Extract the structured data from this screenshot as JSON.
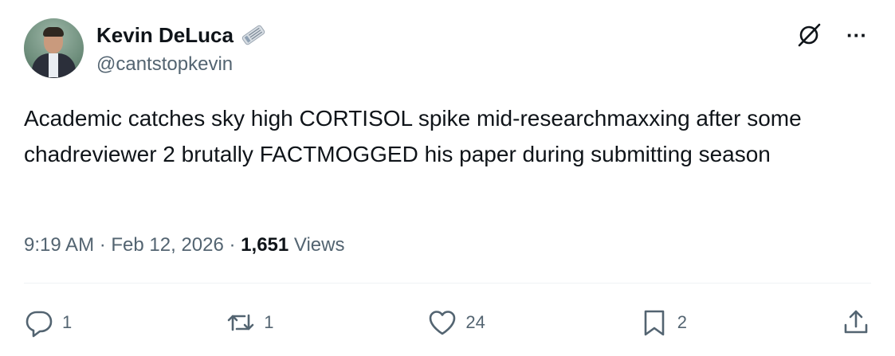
{
  "author": {
    "name": "Kevin DeLuca",
    "handle": "@cantstopkevin",
    "badge_icon": "newspaper-icon"
  },
  "top_icons": [
    "grok-icon",
    "more-icon"
  ],
  "more_label": "···",
  "tweet": {
    "text": "Academic catches sky high CORTISOL spike mid-researchmaxxing after some chadreviewer 2 brutally FACTMOGGED his paper during submitting season"
  },
  "meta": {
    "time": "9:19 AM",
    "sep1": " · ",
    "date": "Feb 12, 2026",
    "sep2": " · ",
    "views_count": "1,651",
    "views_label": " Views"
  },
  "actions": {
    "reply_count": "1",
    "repost_count": "1",
    "like_count": "24",
    "bookmark_count": "2"
  },
  "colors": {
    "text": "#0f1419",
    "secondary": "#536471",
    "divider": "#eff3f4"
  }
}
